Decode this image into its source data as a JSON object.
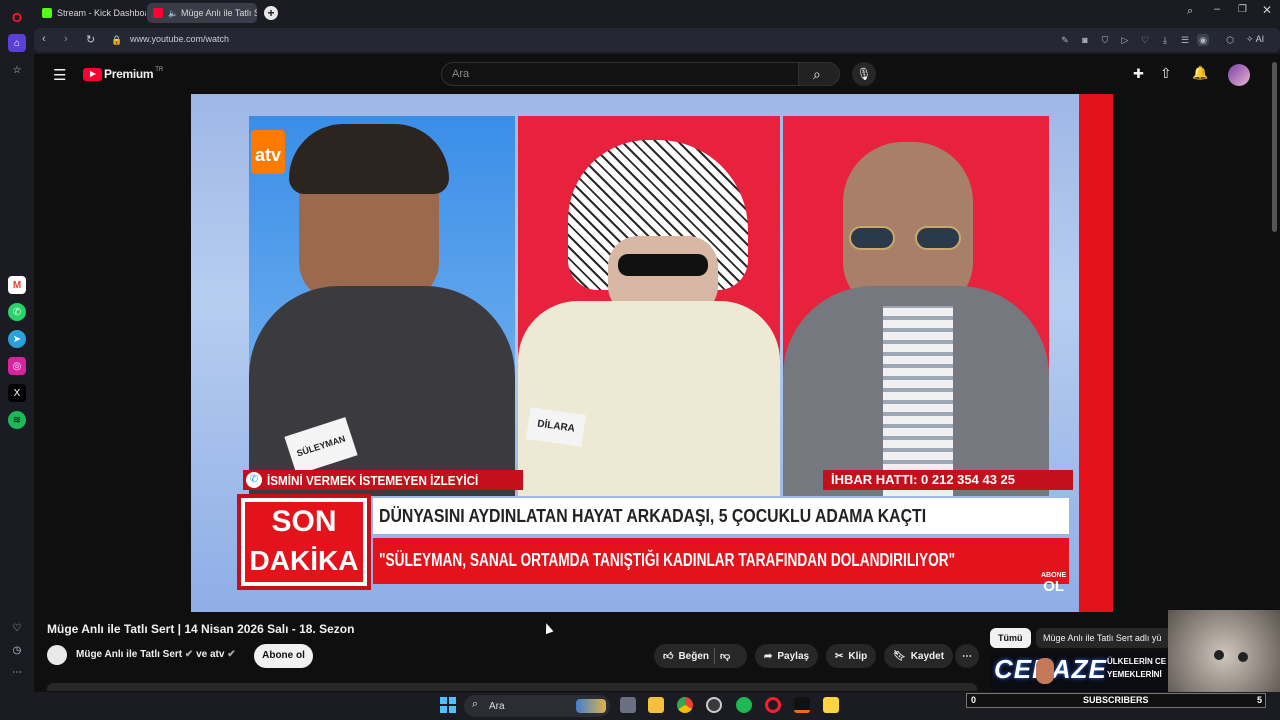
{
  "tabs": [
    {
      "label": "Stream - Kick Dashboard",
      "favicon_color": "#53fc18"
    },
    {
      "label": "Müge Anlı ile Tatlı Sert",
      "favicon_color": "#ff0033"
    }
  ],
  "address": {
    "url": "www.youtube.com/watch",
    "ai_label": "AI"
  },
  "youtube": {
    "brand": "Premium",
    "country": "TR",
    "search_placeholder": "Ara"
  },
  "video": {
    "channel_logo": "atv",
    "name_cards": [
      "SÜLEYMAN",
      "DİLARA"
    ],
    "caller_label": "İSMİNİ VERMEK İSTEMEYEN İZLEYİCİ",
    "hotline": "İHBAR HATTI: 0 212 354 43 25",
    "son": "SON",
    "dakika": "DAKİKA",
    "headline1": "DÜNYASINI AYDINLATAN HAYAT ARKADAŞI, 5 ÇOCUKLU ADAMA KAÇTI",
    "headline2": "\"SÜLEYMAN, SANAL ORTAMDA TANIŞTIĞI KADINLAR TARAFINDAN DOLANDIRILIYOR\"",
    "watermark_top": "ABONE",
    "watermark_bottom": "OL"
  },
  "info": {
    "title": "Müge Anlı ile Tatlı Sert | 14 Nisan 2026 Salı - 18. Sezon",
    "channel": "Müge Anlı ile Tatlı Sert",
    "and_label": "ve atv",
    "subscribe": "Abone ol",
    "like": "Beğen",
    "share": "Paylaş",
    "clip": "Klip",
    "save": "Kaydet"
  },
  "chips": {
    "all": "Tümü",
    "related": "Müge Anlı ile Tatlı Sert adlı yü"
  },
  "overlay": {
    "promo_title": "CENAZE",
    "promo_line1": "ÜLKELERİN CE",
    "promo_line2": "YEMEKLERİNİ",
    "subs_left": "0",
    "subs_label": "SUBSCRIBERS",
    "subs_right": "5"
  },
  "taskbar": {
    "search": "Ara"
  },
  "colors": {
    "yt_red": "#ff0033",
    "breaking_red": "#e3121b",
    "opera_red": "#ff1b2d"
  }
}
